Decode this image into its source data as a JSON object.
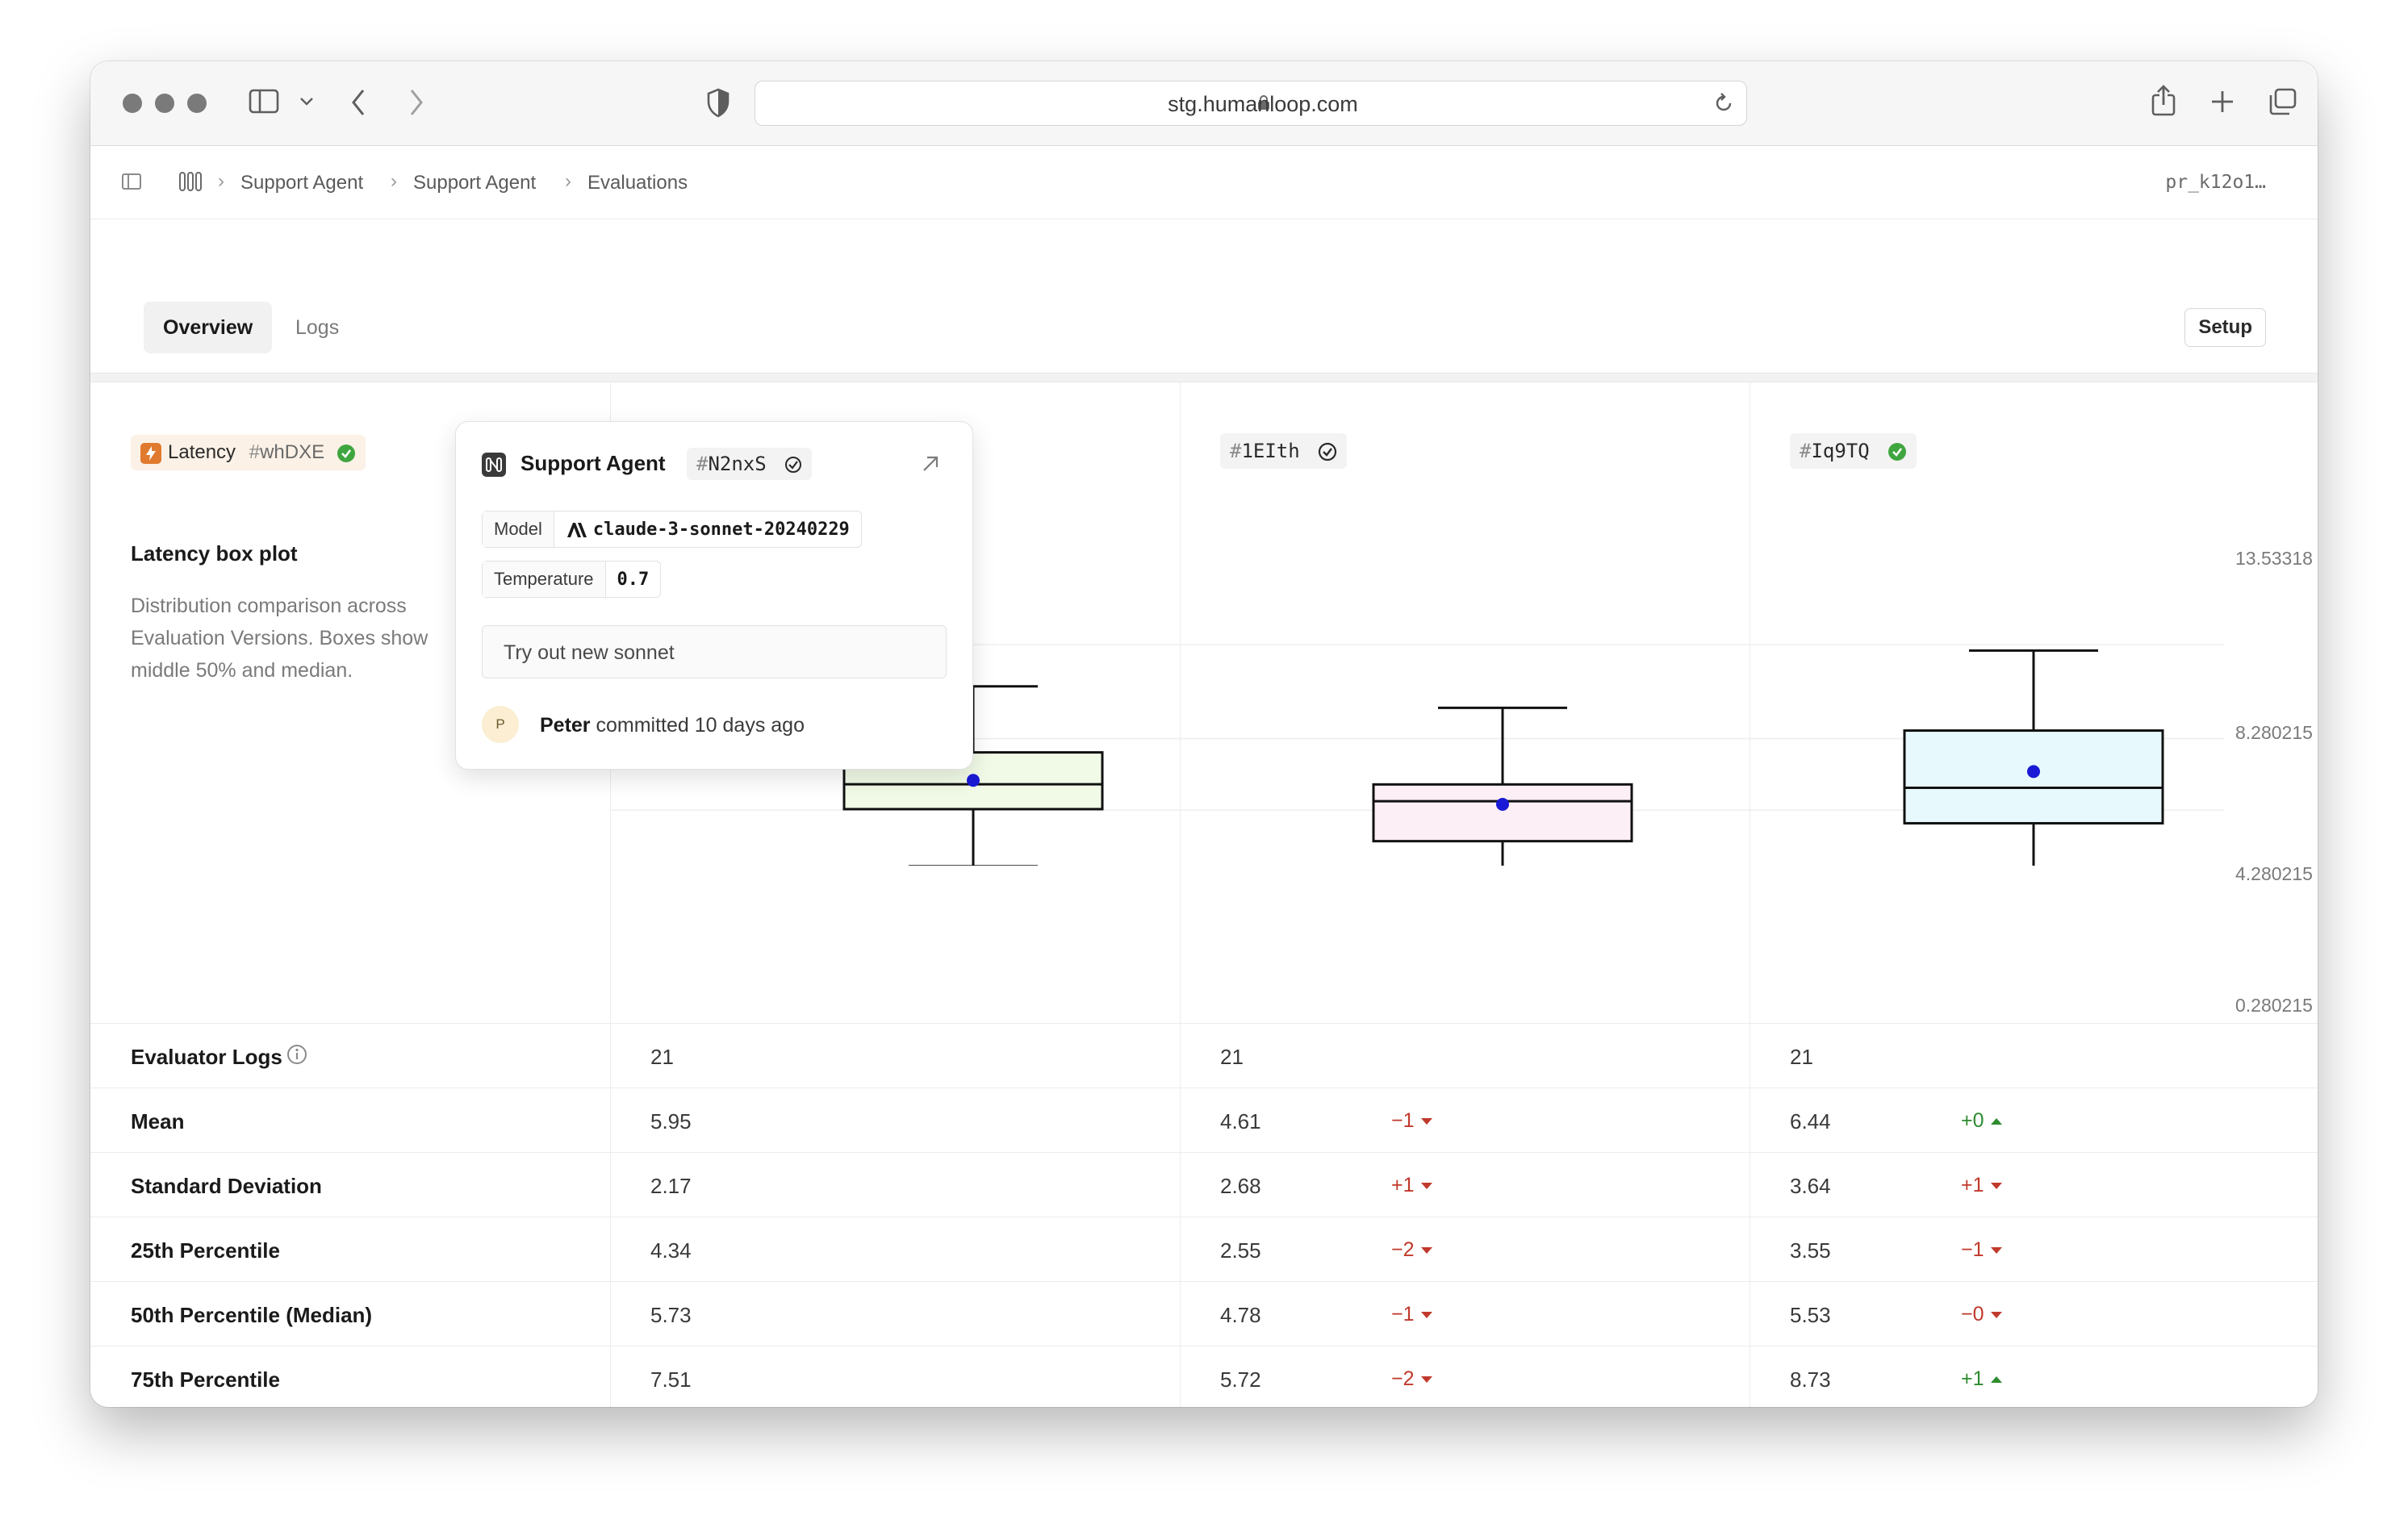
{
  "browser": {
    "url": "stg.humanloop.com"
  },
  "breadcrumb": [
    "Support Agent",
    "Support Agent",
    "Evaluations"
  ],
  "pr_id": "pr_k12o1…",
  "tabs": [
    {
      "label": "Overview",
      "active": true
    },
    {
      "label": "Logs",
      "active": false
    }
  ],
  "setup_label": "Setup",
  "evaluator": {
    "name": "Latency",
    "hash": "#",
    "id": "whDXE"
  },
  "versions": [
    {
      "hash": "#",
      "id": "N2nxS"
    },
    {
      "hash": "#",
      "id": "1EIth"
    },
    {
      "hash": "#",
      "id": "Iq9TQ"
    }
  ],
  "chart_panel": {
    "title": "Latency box plot",
    "description": "Distribution comparison across Evaluation Versions. Boxes show middle 50% and median."
  },
  "chart_data": {
    "type": "box",
    "title": "Latency box plot",
    "y_tick_labels": [
      "13.53318",
      "8.280215",
      "4.280215",
      "0.280215"
    ],
    "series": [
      {
        "name": "N2nxS",
        "color": "#f1fae6",
        "whisker_low": 1.15,
        "q1": 4.34,
        "median": 5.73,
        "q3": 7.51,
        "whisker_high": 11.2,
        "mean": 5.95
      },
      {
        "name": "1EIth",
        "color": "#fdeff6",
        "whisker_low": 0.6,
        "q1": 2.55,
        "median": 4.78,
        "q3": 5.72,
        "whisker_high": 10.0,
        "mean": 4.61
      },
      {
        "name": "Iq9TQ",
        "color": "#e7f9fd",
        "whisker_low": 0.45,
        "q1": 3.55,
        "median": 5.53,
        "q3": 8.73,
        "whisker_high": 13.2,
        "mean": 6.44
      }
    ]
  },
  "popover": {
    "title": "Support Agent",
    "hash": "#",
    "id": "N2nxS",
    "model_label": "Model",
    "model_value": "claude-3-sonnet-20240229",
    "temperature_label": "Temperature",
    "temperature_value": "0.7",
    "message": "Try out new sonnet",
    "avatar_initial": "P",
    "author": "Peter",
    "commit_text": "committed 10 days ago"
  },
  "stats": {
    "info_label": "Evaluator Logs",
    "rows": [
      {
        "label": "Evaluator Logs",
        "values": [
          "21",
          "21",
          "21"
        ],
        "deltas": [
          null,
          null
        ]
      },
      {
        "label": "Mean",
        "values": [
          "5.95",
          "4.61",
          "6.44"
        ],
        "deltas": [
          {
            "text": "−1",
            "dir": "down",
            "tone": "neg"
          },
          {
            "text": "+0",
            "dir": "up",
            "tone": "pos"
          }
        ]
      },
      {
        "label": "Standard Deviation",
        "values": [
          "2.17",
          "2.68",
          "3.64"
        ],
        "deltas": [
          {
            "text": "+1",
            "dir": "down",
            "tone": "neg"
          },
          {
            "text": "+1",
            "dir": "down",
            "tone": "neg"
          }
        ]
      },
      {
        "label": "25th Percentile",
        "values": [
          "4.34",
          "2.55",
          "3.55"
        ],
        "deltas": [
          {
            "text": "−2",
            "dir": "down",
            "tone": "neg"
          },
          {
            "text": "−1",
            "dir": "down",
            "tone": "neg"
          }
        ]
      },
      {
        "label": "50th Percentile (Median)",
        "values": [
          "5.73",
          "4.78",
          "5.53"
        ],
        "deltas": [
          {
            "text": "−1",
            "dir": "down",
            "tone": "neg"
          },
          {
            "text": "−0",
            "dir": "down",
            "tone": "neg"
          }
        ]
      },
      {
        "label": "75th Percentile",
        "values": [
          "7.51",
          "5.72",
          "8.73"
        ],
        "deltas": [
          {
            "text": "−2",
            "dir": "down",
            "tone": "neg"
          },
          {
            "text": "+1",
            "dir": "up",
            "tone": "pos"
          }
        ]
      }
    ]
  }
}
